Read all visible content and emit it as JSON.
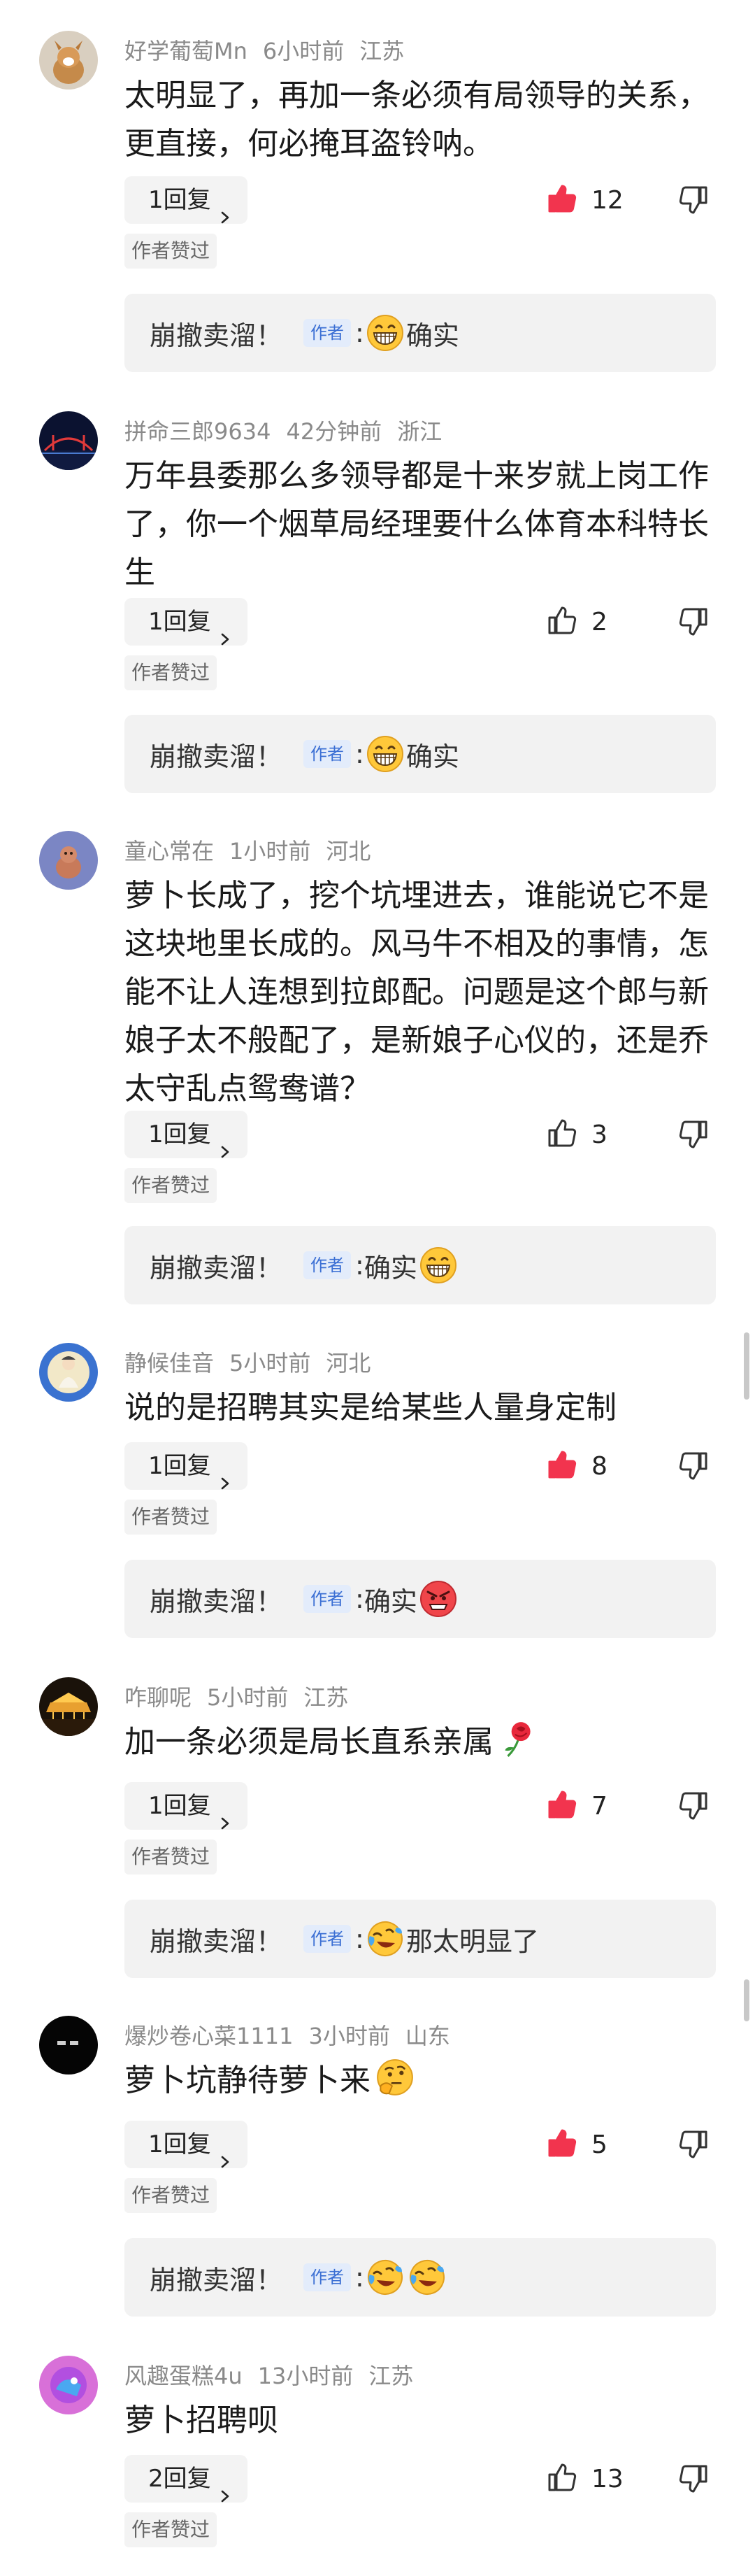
{
  "colors": {
    "like_active": "#f2344e",
    "author_badge_bg": "#e3ecfb",
    "author_badge_text": "#3b6fd4"
  },
  "replier_name": "崩撤卖溜！",
  "author_badge": "作者",
  "liked_by_author": "作者赞过",
  "comments": [
    {
      "user": "好学葡萄Mn",
      "time": "6小时前",
      "region": "江苏",
      "text": "太明显了，再加一条必须有局领导的关系，更直接，何必掩耳盗铃呐。",
      "reply_label": "1回复",
      "likes": "12",
      "liked": true,
      "author_reply": {
        "text": "确实",
        "emojis_before": [
          "grin-emoji"
        ],
        "emojis_after": []
      }
    },
    {
      "user": "拼命三郎9634",
      "time": "42分钟前",
      "region": "浙江",
      "text": "万年县委那么多领导都是十来岁就上岗工作了，你一个烟草局经理要什么体育本科特长生",
      "reply_label": "1回复",
      "likes": "2",
      "liked": false,
      "author_reply": {
        "text": "确实",
        "emojis_before": [
          "grin-emoji"
        ],
        "emojis_after": []
      }
    },
    {
      "user": "童心常在",
      "time": "1小时前",
      "region": "河北",
      "text": "萝卜长成了，挖个坑埋进去，谁能说它不是这块地里长成的。风马牛不相及的事情，怎能不让人连想到拉郎配。问题是这个郎与新娘子太不般配了，是新娘子心仪的，还是乔太守乱点鸳鸯谱？",
      "reply_label": "1回复",
      "likes": "3",
      "liked": false,
      "author_reply": {
        "text": "确实",
        "emojis_before": [],
        "emojis_after": [
          "grin-emoji"
        ]
      }
    },
    {
      "user": "静候佳音",
      "time": "5小时前",
      "region": "河北",
      "text": "说的是招聘其实是给某些人量身定制",
      "reply_label": "1回复",
      "likes": "8",
      "liked": true,
      "author_reply": {
        "text": "确实",
        "emojis_before": [],
        "emojis_after": [
          "angry-emoji"
        ]
      }
    },
    {
      "user": "咋聊呢",
      "time": "5小时前",
      "region": "江苏",
      "text": "加一条必须是局长直系亲属",
      "text_emoji": "rose-emoji",
      "reply_label": "1回复",
      "likes": "7",
      "liked": true,
      "author_reply": {
        "text": "那太明显了",
        "emojis_before": [
          "laugh-cry-emoji"
        ],
        "emojis_after": []
      }
    },
    {
      "user": "爆炒卷心菜1111",
      "time": "3小时前",
      "region": "山东",
      "text": "萝卜坑静待萝卜来",
      "text_emoji": "thinking-emoji",
      "reply_label": "1回复",
      "likes": "5",
      "liked": true,
      "author_reply": {
        "text": "",
        "emojis_before": [
          "laugh-cry-emoji",
          "laugh-cry-emoji"
        ],
        "emojis_after": []
      }
    },
    {
      "user": "风趣蛋糕4u",
      "time": "13小时前",
      "region": "江苏",
      "text": "萝卜招聘呗",
      "reply_label": "2回复",
      "likes": "13",
      "liked": false,
      "author_reply": null
    }
  ]
}
